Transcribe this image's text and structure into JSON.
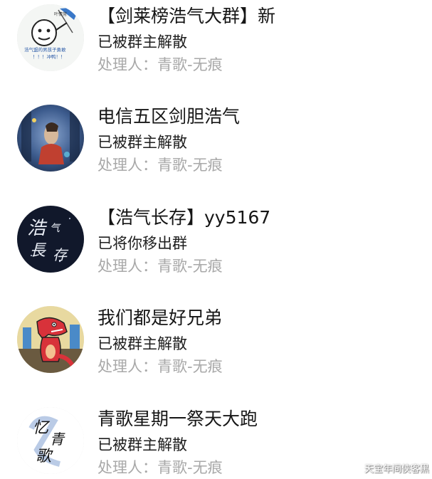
{
  "groups": [
    {
      "title": "【剑莱榜浩气大群】新",
      "status": "已被群主解散",
      "handler": "处理人：青歌-无痕",
      "avatar": {
        "icon": "meme-flag-icon",
        "colors": [
          "#f4f6f4",
          "#3a78c8",
          "#222222"
        ],
        "texts": [
          "叶情常",
          "浩气盟的男孩子勇敢",
          "！！！冲鸭！！"
        ]
      }
    },
    {
      "title": "电信五区剑胆浩气",
      "status": "已被群主解散",
      "handler": "处理人：青歌-无痕",
      "avatar": {
        "icon": "game-screenshot-icon",
        "colors": [
          "#2a4a7a",
          "#6f8fc0",
          "#c04030"
        ]
      }
    },
    {
      "title": "【浩气长存】yy5167",
      "status": "已将你移出群",
      "handler": "处理人：青歌-无痕",
      "avatar": {
        "icon": "calligraphy-icon",
        "colors": [
          "#11182b",
          "#e8ecf4"
        ],
        "texts": [
          "浩",
          "气",
          "長",
          "存"
        ]
      }
    },
    {
      "title": "我们都是好兄弟",
      "status": "已被群主解散",
      "handler": "处理人：青歌-无痕",
      "avatar": {
        "icon": "red-dinosaur-icon",
        "colors": [
          "#e8d9a0",
          "#d8323a",
          "#4a8ac8"
        ]
      }
    },
    {
      "title": "青歌星期一祭天大跑",
      "status": "已被群主解散",
      "handler": "处理人：青歌-无痕",
      "avatar": {
        "icon": "ink-calligraphy-icon",
        "colors": [
          "#ffffff",
          "#3a6ab8",
          "#111111"
        ],
        "texts": [
          "忆",
          "青",
          "歌"
        ]
      }
    }
  ],
  "watermark": "天宝年间侠客黑"
}
